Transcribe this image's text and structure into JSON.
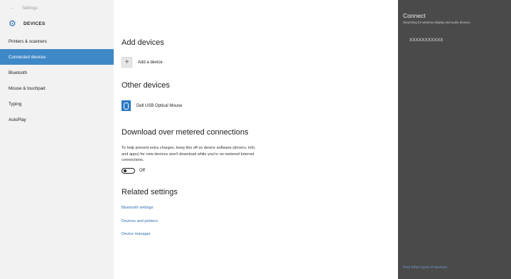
{
  "titlebar": {
    "back_glyph": "←",
    "app_name": "Settings"
  },
  "sidebar": {
    "header_icon": "gear-icon",
    "title": "DEVICES",
    "items": [
      {
        "label": "Printers & scanners",
        "active": false
      },
      {
        "label": "Connected devices",
        "active": true
      },
      {
        "label": "Bluetooth",
        "active": false
      },
      {
        "label": "Mouse & touchpad",
        "active": false
      },
      {
        "label": "Typing",
        "active": false
      },
      {
        "label": "AutoPlay",
        "active": false
      }
    ]
  },
  "main": {
    "add_devices": {
      "heading": "Add devices",
      "button_label": "Add a device",
      "plus_glyph": "+"
    },
    "other_devices": {
      "heading": "Other devices",
      "device_name": "Dell USB Optical Mouse",
      "device_icon": "mouse-icon"
    },
    "metered": {
      "heading": "Download over metered connections",
      "description": "To help prevent extra charges, keep this off so device software (drivers, info, and apps) for new devices won't download while you're on metered Internet connections.",
      "toggle_label": "Off",
      "toggle_on": false
    },
    "related": {
      "heading": "Related settings",
      "links": [
        "Bluetooth settings",
        "Devices and printers",
        "Device manager"
      ]
    }
  },
  "connect_panel": {
    "title": "Connect",
    "subtitle": "Searching for wireless display and audio devices",
    "found_device": "XXXXXXXXXXX",
    "footer_link": "Find other types of devices"
  },
  "colors": {
    "accent": "#3e88c8",
    "link": "#2e6fb5",
    "panel_bg": "#4a4a4a",
    "sidebar_bg": "#f2f2f2"
  }
}
